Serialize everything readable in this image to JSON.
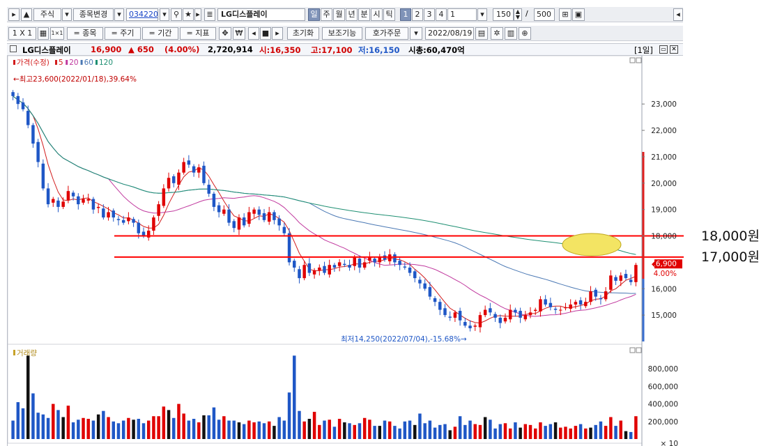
{
  "toolbar1": {
    "market": "주식",
    "change_stock": "종목변경",
    "code": "034220",
    "name": "LG디스플레이",
    "periods": [
      "일",
      "주",
      "월",
      "년",
      "분",
      "시",
      "틱"
    ],
    "nums": [
      "1",
      "2",
      "3",
      "4"
    ],
    "period_value": "1",
    "count": "150",
    "slash": "/",
    "max": "500"
  },
  "toolbar2": {
    "layout": "1 X 1",
    "btn_stock": "= 종목",
    "btn_period": "= 주기",
    "btn_range": "= 기간",
    "btn_indicator": "= 지표",
    "reset": "초기화",
    "aux": "보조기능",
    "order": "호가주문",
    "date": "2022/08/19"
  },
  "info": {
    "name": "LG디스플레이",
    "price": "16,900",
    "change": "▲ 650",
    "pct": "(4.00%)",
    "volume": "2,720,914",
    "open": "시:16,350",
    "high": "고:17,100",
    "low": "저:16,150",
    "mcap": "시총:60,470억",
    "period_tag": "[1일]"
  },
  "legend": {
    "price": "가격(수정)",
    "ma5": "5",
    "ma20": "20",
    "ma60": "60",
    "ma120": "120",
    "volume": "거래량"
  },
  "colors": {
    "up": "#e00000",
    "down": "#1f57c6",
    "ma5": "#d21c1c",
    "ma20": "#c0389e",
    "ma60": "#4a78b4",
    "ma120": "#1e8f72",
    "hline": "#ff0000",
    "ellipse_fill": "#f3e463"
  },
  "price_axis": [
    "23,000",
    "22,000",
    "21,000",
    "20,000",
    "19,000",
    "18,000",
    "16,000",
    "15,000"
  ],
  "current_price_tag": "16,900",
  "current_pct_tag": "4.00%",
  "max_label": "최고23,600(2022/01/18),39.64%",
  "min_label": "최저14,250(2022/07/04),-15.68%",
  "volume_axis": [
    "800,000",
    "600,000",
    "400,000",
    "200,000",
    "× 10"
  ],
  "annotations": {
    "line_18000": "18,000원",
    "line_17000": "17,000원"
  },
  "chart_data": {
    "type": "candlestick",
    "ylim": [
      14000,
      24300
    ],
    "hlines": [
      18000,
      17200
    ],
    "close": [
      23300,
      23000,
      22800,
      22200,
      21500,
      20800,
      19800,
      19200,
      19400,
      19100,
      19300,
      19700,
      19500,
      19200,
      19400,
      19400,
      19000,
      19100,
      18700,
      18900,
      18700,
      18600,
      18500,
      18700,
      18500,
      18100,
      18000,
      18200,
      18700,
      19200,
      19800,
      20200,
      20000,
      20400,
      20800,
      20700,
      20400,
      20600,
      20000,
      19600,
      19100,
      18900,
      19000,
      18500,
      18300,
      18700,
      18400,
      18900,
      19000,
      18800,
      18600,
      18900,
      18600,
      18400,
      18100,
      17000,
      16800,
      16400,
      16900,
      16600,
      16700,
      16800,
      16600,
      16900,
      16800,
      17000,
      16900,
      16800,
      17200,
      16800,
      17000,
      17200,
      17000,
      17200,
      17100,
      17300,
      17000,
      16900,
      16800,
      16600,
      16400,
      16200,
      16000,
      15700,
      15500,
      15200,
      15000,
      14900,
      15100,
      14800,
      14600,
      14500,
      14600,
      15000,
      15200,
      15100,
      14900,
      14700,
      14900,
      15200,
      15100,
      14900,
      15000,
      15100,
      15200,
      15600,
      15400,
      15300,
      15200,
      15200,
      15300,
      15400,
      15500,
      15400,
      15500,
      15900,
      15700,
      15600,
      15900,
      16500,
      16300,
      16500,
      16400,
      16250,
      16900
    ],
    "volume": [
      210,
      420,
      350,
      950,
      520,
      300,
      280,
      240,
      400,
      330,
      250,
      380,
      190,
      220,
      240,
      230,
      210,
      280,
      320,
      250,
      200,
      180,
      210,
      240,
      220,
      230,
      180,
      210,
      260,
      260,
      370,
      330,
      240,
      400,
      290,
      210,
      230,
      190,
      270,
      270,
      360,
      220,
      260,
      210,
      210,
      190,
      170,
      210,
      190,
      200,
      180,
      200,
      150,
      250,
      210,
      530,
      950,
      320,
      200,
      230,
      310,
      160,
      210,
      220,
      140,
      230,
      190,
      180,
      160,
      180,
      240,
      220,
      150,
      150,
      210,
      200,
      150,
      120,
      200,
      210,
      160,
      290,
      180,
      210,
      130,
      160,
      170,
      100,
      140,
      260,
      160,
      210,
      170,
      160,
      250,
      220,
      120,
      170,
      180,
      120,
      190,
      130,
      170,
      160,
      120,
      190,
      150,
      170,
      190,
      130,
      140,
      120,
      150,
      170,
      120,
      130,
      160,
      200,
      150,
      250,
      150,
      210,
      90,
      80,
      260
    ]
  }
}
